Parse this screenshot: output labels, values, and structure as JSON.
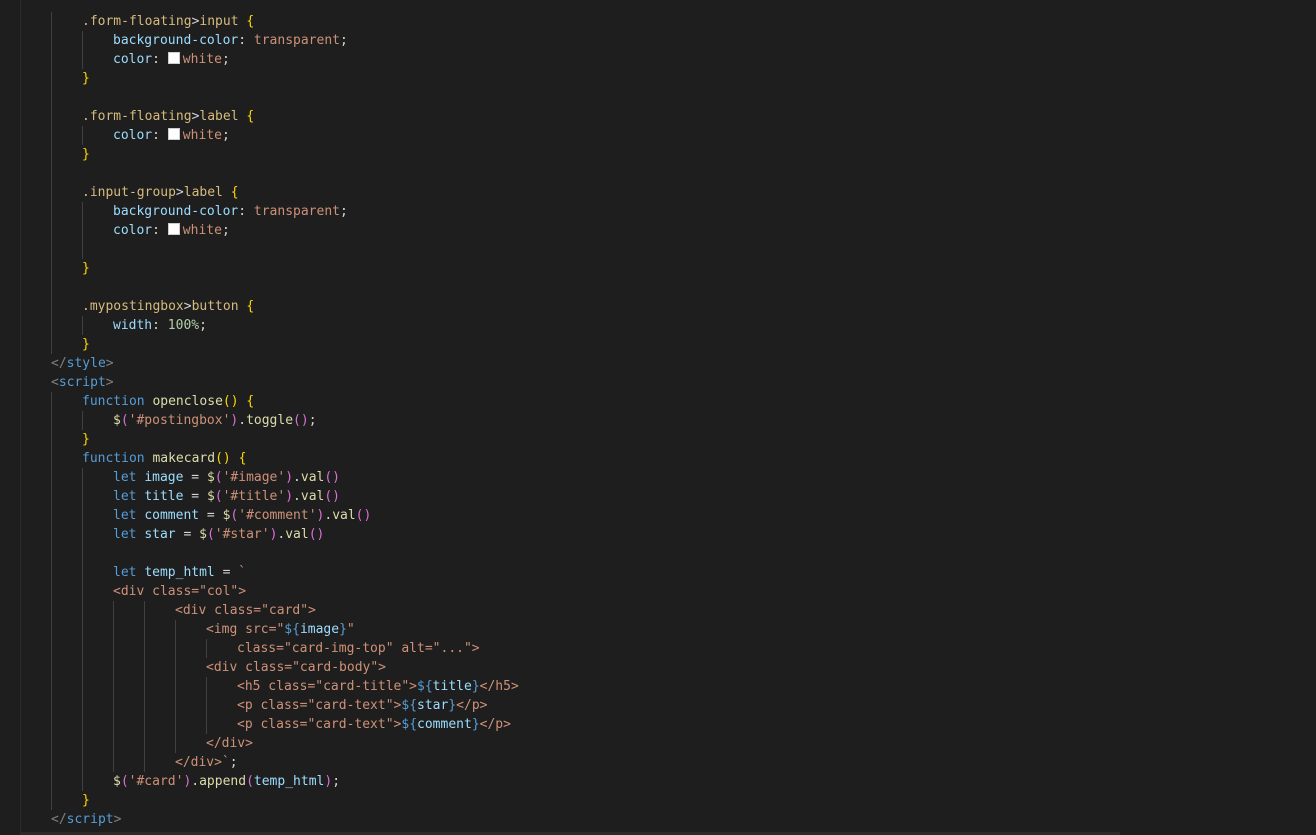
{
  "colors": {
    "background": "#1e1e1e",
    "selector": "#d7ba7d",
    "property": "#9cdcfe",
    "string": "#ce9178",
    "number": "#b5cea8",
    "keyword": "#569cd6",
    "function": "#dcdcaa",
    "bracket_level1": "#ffd700",
    "bracket_level2": "#da70d6",
    "bracket_level3": "#179fff",
    "tag_angle": "#808080"
  },
  "code_lines": [
    {
      "indent": 2,
      "guides": [
        1
      ],
      "tokens": [
        {
          "t": ".form-floating",
          "c": "sel"
        },
        {
          "t": ">",
          "c": "punc"
        },
        {
          "t": "input",
          "c": "sel"
        },
        {
          "t": " ",
          "c": "punc"
        },
        {
          "t": "{",
          "c": "b1"
        }
      ]
    },
    {
      "indent": 3,
      "guides": [
        1,
        2
      ],
      "tokens": [
        {
          "t": "background-color",
          "c": "prop"
        },
        {
          "t": ": ",
          "c": "punc"
        },
        {
          "t": "transparent",
          "c": "val"
        },
        {
          "t": ";",
          "c": "punc"
        }
      ]
    },
    {
      "indent": 3,
      "guides": [
        1,
        2
      ],
      "tokens": [
        {
          "t": "color",
          "c": "prop"
        },
        {
          "t": ": ",
          "c": "punc"
        },
        {
          "t": "",
          "c": "swatch"
        },
        {
          "t": "white",
          "c": "val"
        },
        {
          "t": ";",
          "c": "punc"
        }
      ]
    },
    {
      "indent": 2,
      "guides": [
        1
      ],
      "tokens": [
        {
          "t": "}",
          "c": "b1"
        }
      ]
    },
    {
      "indent": 0,
      "guides": [
        1
      ],
      "tokens": []
    },
    {
      "indent": 2,
      "guides": [
        1
      ],
      "tokens": [
        {
          "t": ".form-floating",
          "c": "sel"
        },
        {
          "t": ">",
          "c": "punc"
        },
        {
          "t": "label",
          "c": "sel"
        },
        {
          "t": " ",
          "c": "punc"
        },
        {
          "t": "{",
          "c": "b1"
        }
      ]
    },
    {
      "indent": 3,
      "guides": [
        1,
        2
      ],
      "tokens": [
        {
          "t": "color",
          "c": "prop"
        },
        {
          "t": ": ",
          "c": "punc"
        },
        {
          "t": "",
          "c": "swatch"
        },
        {
          "t": "white",
          "c": "val"
        },
        {
          "t": ";",
          "c": "punc"
        }
      ]
    },
    {
      "indent": 2,
      "guides": [
        1
      ],
      "tokens": [
        {
          "t": "}",
          "c": "b1"
        }
      ]
    },
    {
      "indent": 0,
      "guides": [
        1
      ],
      "tokens": []
    },
    {
      "indent": 2,
      "guides": [
        1
      ],
      "tokens": [
        {
          "t": ".input-group",
          "c": "sel"
        },
        {
          "t": ">",
          "c": "punc"
        },
        {
          "t": "label",
          "c": "sel"
        },
        {
          "t": " ",
          "c": "punc"
        },
        {
          "t": "{",
          "c": "b1"
        }
      ]
    },
    {
      "indent": 3,
      "guides": [
        1,
        2
      ],
      "tokens": [
        {
          "t": "background-color",
          "c": "prop"
        },
        {
          "t": ": ",
          "c": "punc"
        },
        {
          "t": "transparent",
          "c": "val"
        },
        {
          "t": ";",
          "c": "punc"
        }
      ]
    },
    {
      "indent": 3,
      "guides": [
        1,
        2
      ],
      "tokens": [
        {
          "t": "color",
          "c": "prop"
        },
        {
          "t": ": ",
          "c": "punc"
        },
        {
          "t": "",
          "c": "swatch"
        },
        {
          "t": "white",
          "c": "val"
        },
        {
          "t": ";",
          "c": "punc"
        }
      ]
    },
    {
      "indent": 0,
      "guides": [
        1,
        2
      ],
      "tokens": []
    },
    {
      "indent": 2,
      "guides": [
        1
      ],
      "tokens": [
        {
          "t": "}",
          "c": "b1"
        }
      ]
    },
    {
      "indent": 0,
      "guides": [
        1
      ],
      "tokens": []
    },
    {
      "indent": 2,
      "guides": [
        1
      ],
      "tokens": [
        {
          "t": ".mypostingbox",
          "c": "sel"
        },
        {
          "t": ">",
          "c": "punc"
        },
        {
          "t": "button",
          "c": "sel"
        },
        {
          "t": " ",
          "c": "punc"
        },
        {
          "t": "{",
          "c": "b1"
        }
      ]
    },
    {
      "indent": 3,
      "guides": [
        1,
        2
      ],
      "tokens": [
        {
          "t": "width",
          "c": "prop"
        },
        {
          "t": ": ",
          "c": "punc"
        },
        {
          "t": "100%",
          "c": "num"
        },
        {
          "t": ";",
          "c": "punc"
        }
      ]
    },
    {
      "indent": 2,
      "guides": [
        1
      ],
      "tokens": [
        {
          "t": "}",
          "c": "b1"
        }
      ]
    },
    {
      "indent": 1,
      "guides": [],
      "tokens": [
        {
          "t": "</",
          "c": "angle"
        },
        {
          "t": "style",
          "c": "tag"
        },
        {
          "t": ">",
          "c": "angle"
        }
      ]
    },
    {
      "indent": 1,
      "guides": [],
      "tokens": [
        {
          "t": "<",
          "c": "angle"
        },
        {
          "t": "script",
          "c": "tag"
        },
        {
          "t": ">",
          "c": "angle"
        }
      ]
    },
    {
      "indent": 2,
      "guides": [
        1
      ],
      "tokens": [
        {
          "t": "function",
          "c": "kw"
        },
        {
          "t": " ",
          "c": "punc"
        },
        {
          "t": "openclose",
          "c": "fn"
        },
        {
          "t": "()",
          "c": "b1"
        },
        {
          "t": " ",
          "c": "punc"
        },
        {
          "t": "{",
          "c": "b1"
        }
      ]
    },
    {
      "indent": 3,
      "guides": [
        1,
        2
      ],
      "tokens": [
        {
          "t": "$",
          "c": "fn"
        },
        {
          "t": "(",
          "c": "b2"
        },
        {
          "t": "'#postingbox'",
          "c": "str"
        },
        {
          "t": ")",
          "c": "b2"
        },
        {
          "t": ".",
          "c": "punc"
        },
        {
          "t": "toggle",
          "c": "fn"
        },
        {
          "t": "()",
          "c": "b2"
        },
        {
          "t": ";",
          "c": "punc"
        }
      ]
    },
    {
      "indent": 2,
      "guides": [
        1
      ],
      "tokens": [
        {
          "t": "}",
          "c": "b1"
        }
      ]
    },
    {
      "indent": 2,
      "guides": [
        1
      ],
      "tokens": [
        {
          "t": "function",
          "c": "kw"
        },
        {
          "t": " ",
          "c": "punc"
        },
        {
          "t": "makecard",
          "c": "fn"
        },
        {
          "t": "()",
          "c": "b1"
        },
        {
          "t": " ",
          "c": "punc"
        },
        {
          "t": "{",
          "c": "b1"
        }
      ]
    },
    {
      "indent": 3,
      "guides": [
        1,
        2
      ],
      "tokens": [
        {
          "t": "let",
          "c": "kw"
        },
        {
          "t": " ",
          "c": "punc"
        },
        {
          "t": "image",
          "c": "var"
        },
        {
          "t": " = ",
          "c": "punc"
        },
        {
          "t": "$",
          "c": "fn"
        },
        {
          "t": "(",
          "c": "b2"
        },
        {
          "t": "'#image'",
          "c": "str"
        },
        {
          "t": ")",
          "c": "b2"
        },
        {
          "t": ".",
          "c": "punc"
        },
        {
          "t": "val",
          "c": "fn"
        },
        {
          "t": "()",
          "c": "b2"
        }
      ]
    },
    {
      "indent": 3,
      "guides": [
        1,
        2
      ],
      "tokens": [
        {
          "t": "let",
          "c": "kw"
        },
        {
          "t": " ",
          "c": "punc"
        },
        {
          "t": "title",
          "c": "var"
        },
        {
          "t": " = ",
          "c": "punc"
        },
        {
          "t": "$",
          "c": "fn"
        },
        {
          "t": "(",
          "c": "b2"
        },
        {
          "t": "'#title'",
          "c": "str"
        },
        {
          "t": ")",
          "c": "b2"
        },
        {
          "t": ".",
          "c": "punc"
        },
        {
          "t": "val",
          "c": "fn"
        },
        {
          "t": "()",
          "c": "b2"
        }
      ]
    },
    {
      "indent": 3,
      "guides": [
        1,
        2
      ],
      "tokens": [
        {
          "t": "let",
          "c": "kw"
        },
        {
          "t": " ",
          "c": "punc"
        },
        {
          "t": "comment",
          "c": "var"
        },
        {
          "t": " = ",
          "c": "punc"
        },
        {
          "t": "$",
          "c": "fn"
        },
        {
          "t": "(",
          "c": "b2"
        },
        {
          "t": "'#comment'",
          "c": "str"
        },
        {
          "t": ")",
          "c": "b2"
        },
        {
          "t": ".",
          "c": "punc"
        },
        {
          "t": "val",
          "c": "fn"
        },
        {
          "t": "()",
          "c": "b2"
        }
      ]
    },
    {
      "indent": 3,
      "guides": [
        1,
        2
      ],
      "tokens": [
        {
          "t": "let",
          "c": "kw"
        },
        {
          "t": " ",
          "c": "punc"
        },
        {
          "t": "star",
          "c": "var"
        },
        {
          "t": " = ",
          "c": "punc"
        },
        {
          "t": "$",
          "c": "fn"
        },
        {
          "t": "(",
          "c": "b2"
        },
        {
          "t": "'#star'",
          "c": "str"
        },
        {
          "t": ")",
          "c": "b2"
        },
        {
          "t": ".",
          "c": "punc"
        },
        {
          "t": "val",
          "c": "fn"
        },
        {
          "t": "()",
          "c": "b2"
        }
      ]
    },
    {
      "indent": 0,
      "guides": [
        1,
        2
      ],
      "tokens": []
    },
    {
      "indent": 3,
      "guides": [
        1,
        2
      ],
      "tokens": [
        {
          "t": "let",
          "c": "kw"
        },
        {
          "t": " ",
          "c": "punc"
        },
        {
          "t": "temp_html",
          "c": "var"
        },
        {
          "t": " = ",
          "c": "punc"
        },
        {
          "t": "`",
          "c": "str"
        }
      ]
    },
    {
      "indent": 3,
      "guides": [
        1,
        2
      ],
      "tokens": [
        {
          "t": "<div class=\"col\">",
          "c": "str"
        }
      ]
    },
    {
      "indent": 5,
      "guides": [
        1,
        2,
        3,
        4
      ],
      "tokens": [
        {
          "t": "<div class=\"card\">",
          "c": "str"
        }
      ]
    },
    {
      "indent": 6,
      "guides": [
        1,
        2,
        3,
        4,
        5
      ],
      "tokens": [
        {
          "t": "<img src=\"",
          "c": "str"
        },
        {
          "t": "${",
          "c": "tmpl"
        },
        {
          "t": "image",
          "c": "var"
        },
        {
          "t": "}",
          "c": "tmpl"
        },
        {
          "t": "\"",
          "c": "str"
        }
      ]
    },
    {
      "indent": 7,
      "guides": [
        1,
        2,
        3,
        4,
        5,
        6
      ],
      "tokens": [
        {
          "t": "class=\"card-img-top\" alt=\"...\">",
          "c": "str"
        }
      ]
    },
    {
      "indent": 6,
      "guides": [
        1,
        2,
        3,
        4,
        5
      ],
      "tokens": [
        {
          "t": "<div class=\"card-body\">",
          "c": "str"
        }
      ]
    },
    {
      "indent": 7,
      "guides": [
        1,
        2,
        3,
        4,
        5,
        6
      ],
      "tokens": [
        {
          "t": "<h5 class=\"card-title\">",
          "c": "str"
        },
        {
          "t": "${",
          "c": "tmpl"
        },
        {
          "t": "title",
          "c": "var"
        },
        {
          "t": "}",
          "c": "tmpl"
        },
        {
          "t": "</h5>",
          "c": "str"
        }
      ]
    },
    {
      "indent": 7,
      "guides": [
        1,
        2,
        3,
        4,
        5,
        6
      ],
      "tokens": [
        {
          "t": "<p class=\"card-text\">",
          "c": "str"
        },
        {
          "t": "${",
          "c": "tmpl"
        },
        {
          "t": "star",
          "c": "var"
        },
        {
          "t": "}",
          "c": "tmpl"
        },
        {
          "t": "</p>",
          "c": "str"
        }
      ]
    },
    {
      "indent": 7,
      "guides": [
        1,
        2,
        3,
        4,
        5,
        6
      ],
      "tokens": [
        {
          "t": "<p class=\"card-text\">",
          "c": "str"
        },
        {
          "t": "${",
          "c": "tmpl"
        },
        {
          "t": "comment",
          "c": "var"
        },
        {
          "t": "}",
          "c": "tmpl"
        },
        {
          "t": "</p>",
          "c": "str"
        }
      ]
    },
    {
      "indent": 6,
      "guides": [
        1,
        2,
        3,
        4,
        5
      ],
      "tokens": [
        {
          "t": "</div>",
          "c": "str"
        }
      ]
    },
    {
      "indent": 5,
      "guides": [
        1,
        2,
        3,
        4
      ],
      "tokens": [
        {
          "t": "</div>`",
          "c": "str"
        },
        {
          "t": ";",
          "c": "punc"
        }
      ]
    },
    {
      "indent": 3,
      "guides": [
        1,
        2
      ],
      "tokens": [
        {
          "t": "$",
          "c": "fn"
        },
        {
          "t": "(",
          "c": "b2"
        },
        {
          "t": "'#card'",
          "c": "str"
        },
        {
          "t": ")",
          "c": "b2"
        },
        {
          "t": ".",
          "c": "punc"
        },
        {
          "t": "append",
          "c": "fn"
        },
        {
          "t": "(",
          "c": "b2"
        },
        {
          "t": "temp_html",
          "c": "var"
        },
        {
          "t": ")",
          "c": "b2"
        },
        {
          "t": ";",
          "c": "punc"
        }
      ]
    },
    {
      "indent": 2,
      "guides": [
        1
      ],
      "tokens": [
        {
          "t": "}",
          "c": "b1"
        }
      ]
    },
    {
      "indent": 1,
      "guides": [],
      "tokens": [
        {
          "t": "</",
          "c": "angle"
        },
        {
          "t": "script",
          "c": "tag"
        },
        {
          "t": ">",
          "c": "angle"
        }
      ]
    }
  ]
}
